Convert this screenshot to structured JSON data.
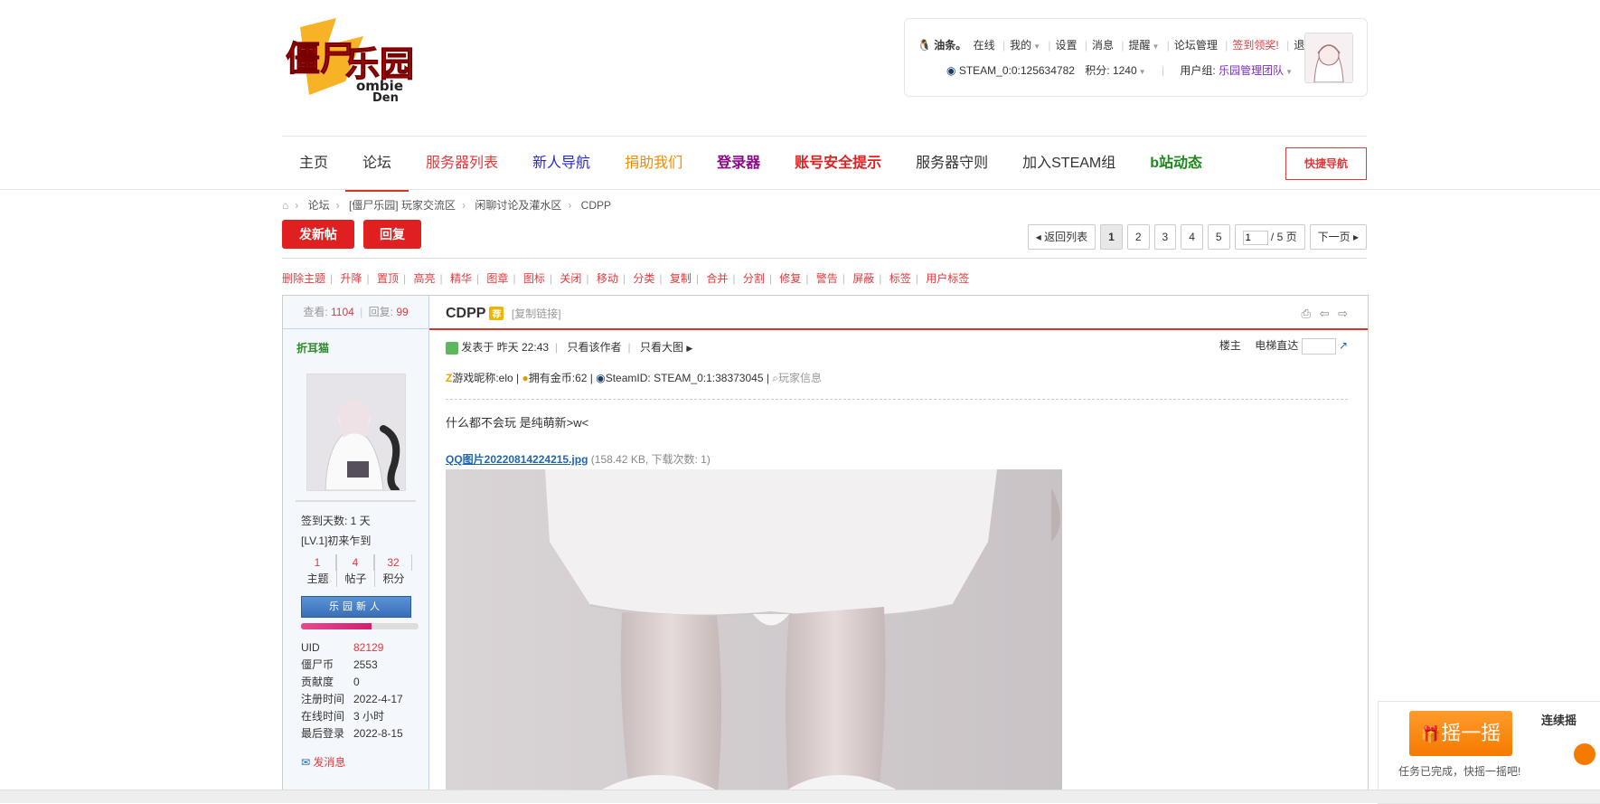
{
  "logo": {
    "text_main": "僵尸乐园",
    "text_en": "Zombie Den"
  },
  "user": {
    "name": "油条。",
    "status": "在线",
    "links": [
      "我的",
      "设置",
      "消息",
      "提醒",
      "论坛管理"
    ],
    "checkin": "签到领奖!",
    "logout": "退出",
    "steam": "STEAM_0:0:125634782",
    "points": "积分: 1240",
    "group_label": "用户组:",
    "group": "乐园管理团队"
  },
  "nav": {
    "items": [
      {
        "label": "主页",
        "color": "#333333"
      },
      {
        "label": "论坛",
        "color": "#333333"
      },
      {
        "label": "服务器列表",
        "color": "#e4393c"
      },
      {
        "label": "新人导航",
        "color": "#2a2ad0"
      },
      {
        "label": "捐助我们",
        "color": "#f08c00"
      },
      {
        "label": "登录器",
        "color": "#8a0a8a"
      },
      {
        "label": "账号安全提示",
        "color": "#e02020"
      },
      {
        "label": "服务器守则",
        "color": "#333333"
      },
      {
        "label": "加入STEAM组",
        "color": "#333333"
      },
      {
        "label": "b站动态",
        "color": "#1a8a1a"
      }
    ],
    "quick": "快捷导航"
  },
  "breadcrumb": [
    "论坛",
    "[僵尸乐园] 玩家交流区",
    "闲聊讨论及灌水区",
    "CDPP"
  ],
  "actions": {
    "new_thread": "发新帖",
    "reply": "回复"
  },
  "pager": {
    "back": "返回列表",
    "pages": [
      "1",
      "2",
      "3",
      "4",
      "5"
    ],
    "current_input": "1",
    "total": "/ 5 页",
    "next": "下一页"
  },
  "mod_tools": [
    "删除主题",
    "升降",
    "置顶",
    "高亮",
    "精华",
    "图章",
    "图标",
    "关闭",
    "移动",
    "分类",
    "复制",
    "合并",
    "分割",
    "修复",
    "警告",
    "屏蔽",
    "标签",
    "用户标签"
  ],
  "thread": {
    "views_label": "查看:",
    "views": "1104",
    "replies_label": "回复:",
    "replies": "99",
    "title": "CDPP",
    "copy_link": "[复制链接]"
  },
  "author": {
    "name": "折耳猫",
    "checkin_days": "签到天数: 1 天",
    "level": "[LV.1]初来乍到",
    "stats": [
      {
        "num": "1",
        "label": "主题"
      },
      {
        "num": "4",
        "label": "帖子"
      },
      {
        "num": "32",
        "label": "积分"
      }
    ],
    "medal": "乐园新人",
    "progress": 0.6,
    "info": [
      {
        "k": "UID",
        "v": "82129",
        "red": true
      },
      {
        "k": "僵尸币",
        "v": "2553",
        "red": false
      },
      {
        "k": "贡献度",
        "v": "0",
        "red": false
      },
      {
        "k": "注册时间",
        "v": "2022-4-17",
        "red": false
      },
      {
        "k": "在线时间",
        "v": "3 小时",
        "red": false
      },
      {
        "k": "最后登录",
        "v": "2022-8-15",
        "red": false
      }
    ],
    "send_msg": "发消息"
  },
  "post": {
    "posted": "发表于 昨天 22:43",
    "only_author": "只看该作者",
    "big_image": "只看大图",
    "floor": "楼主",
    "jump": "电梯直达",
    "ext_nick": "游戏昵称:elo",
    "ext_coins": "拥有金币:62",
    "ext_steam": "SteamID: STEAM_0:1:38373045",
    "ext_info": "玩家信息",
    "content": "什么都不会玩 是纯萌新>w<",
    "attachment": "QQ图片20220814224215.jpg",
    "attachment_info": "(158.42 KB, 下载次数: 1)"
  },
  "shake": {
    "button": "摇一摇",
    "tip": "任务已完成，快摇一摇吧!",
    "right_title": "连续摇"
  }
}
